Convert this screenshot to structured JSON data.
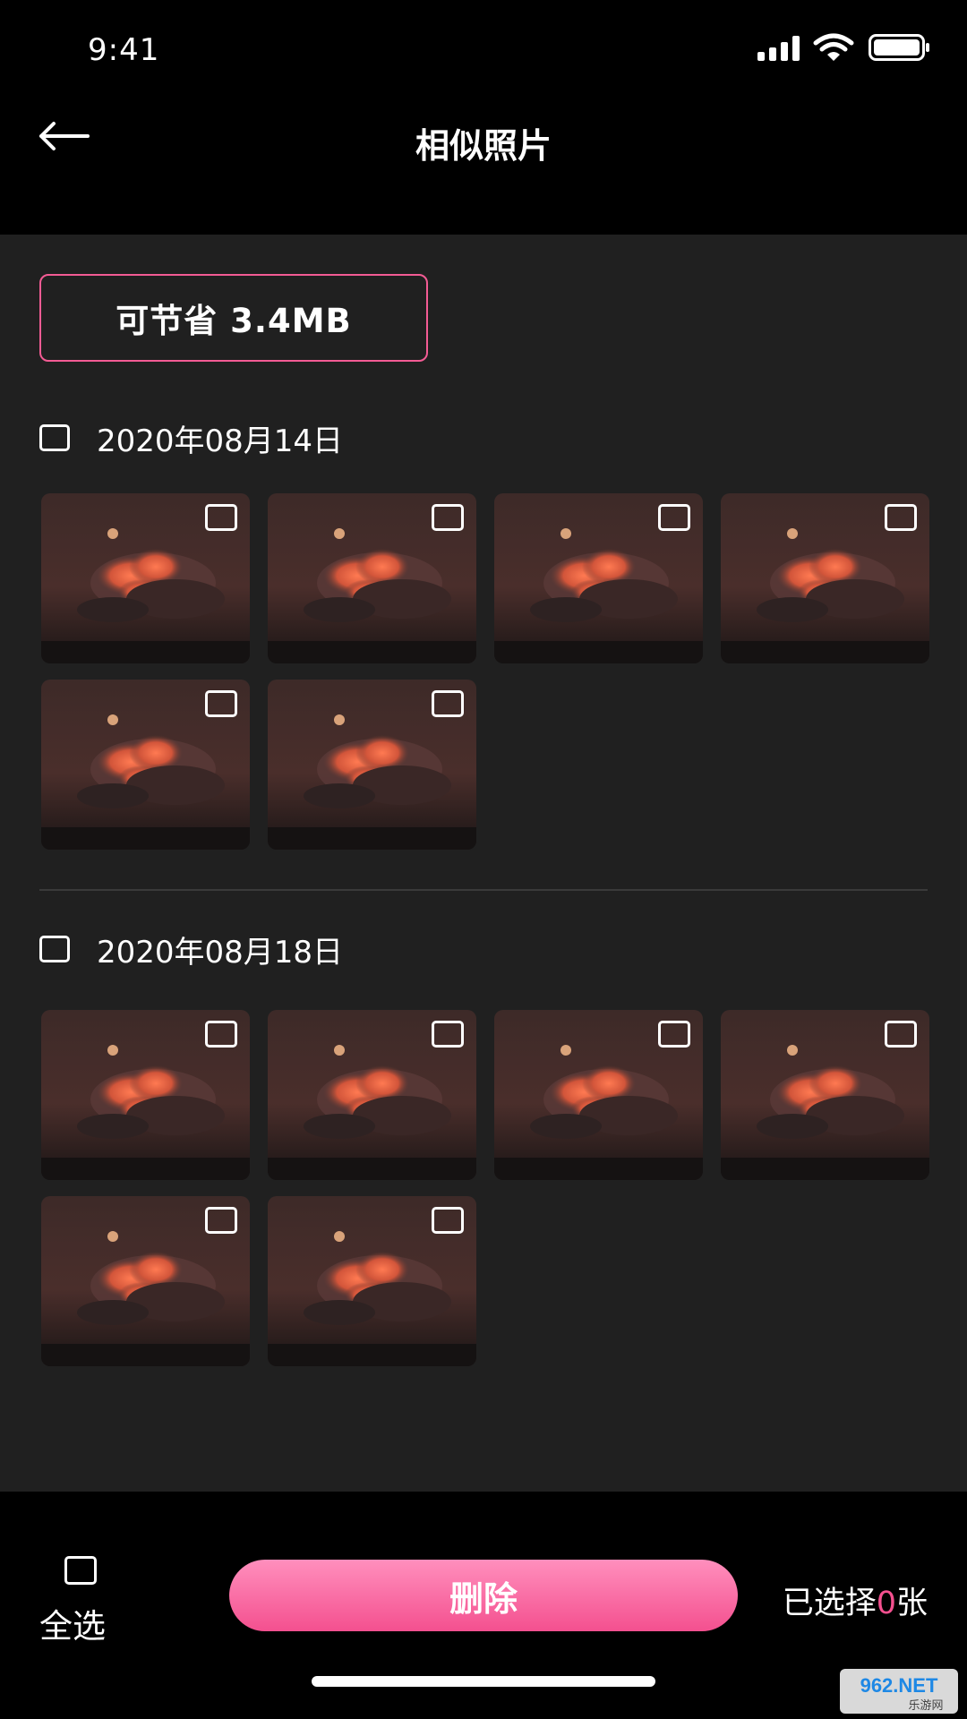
{
  "status_bar": {
    "time": "9:41"
  },
  "header": {
    "title": "相似照片"
  },
  "savings": {
    "label": "可节省 3.4MB"
  },
  "groups": [
    {
      "date": "2020年08月14日",
      "photo_count": 6
    },
    {
      "date": "2020年08月18日",
      "photo_count": 6
    }
  ],
  "bottom_bar": {
    "select_all_label": "全选",
    "delete_label": "删除",
    "selected_prefix": "已选择",
    "selected_count": "0",
    "selected_suffix": "张"
  },
  "watermark": {
    "text": "962.NET",
    "subtext": "乐游网"
  },
  "colors": {
    "accent": "#f4508f",
    "background": "#202020",
    "bar": "#000000"
  }
}
